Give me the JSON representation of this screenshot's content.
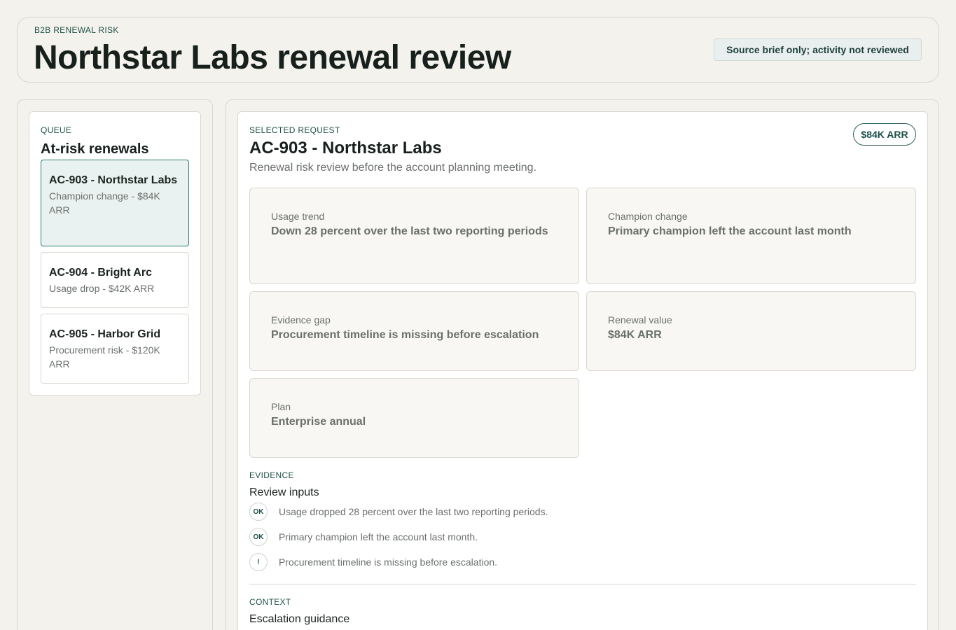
{
  "header": {
    "eyebrow": "B2B RENEWAL RISK",
    "title": "Northstar Labs renewal review",
    "source_status": "Source brief only; activity not reviewed"
  },
  "queue": {
    "eyebrow": "QUEUE",
    "title": "At-risk renewals",
    "items": [
      {
        "title": "AC-903 - Northstar Labs",
        "subtitle": "Champion change - $84K ARR",
        "selected": true
      },
      {
        "title": "AC-904 - Bright Arc",
        "subtitle": "Usage drop - $42K ARR",
        "selected": false
      },
      {
        "title": "AC-905 - Harbor Grid",
        "subtitle": "Procurement risk - $120K ARR",
        "selected": false
      }
    ]
  },
  "request": {
    "eyebrow": "SELECTED REQUEST",
    "title": "AC-903 - Northstar Labs",
    "subtitle": "Renewal risk review before the account planning meeting.",
    "arr_badge": "$84K ARR",
    "facts": [
      {
        "label": "Usage trend",
        "value": "Down 28 percent over the last two reporting periods"
      },
      {
        "label": "Champion change",
        "value": "Primary champion left the account last month"
      },
      {
        "label": "Evidence gap",
        "value": "Procurement timeline is missing before escalation"
      },
      {
        "label": "Renewal value",
        "value": "$84K ARR"
      },
      {
        "label": "Plan",
        "value": "Enterprise annual"
      }
    ]
  },
  "evidence": {
    "eyebrow": "EVIDENCE",
    "title": "Review inputs",
    "items": [
      {
        "badge": "OK",
        "text": "Usage dropped 28 percent over the last two reporting periods."
      },
      {
        "badge": "OK",
        "text": "Primary champion left the account last month."
      },
      {
        "badge": "!",
        "text": "Procurement timeline is missing before escalation."
      }
    ]
  },
  "context": {
    "eyebrow": "CONTEXT",
    "title": "Escalation guidance"
  }
}
